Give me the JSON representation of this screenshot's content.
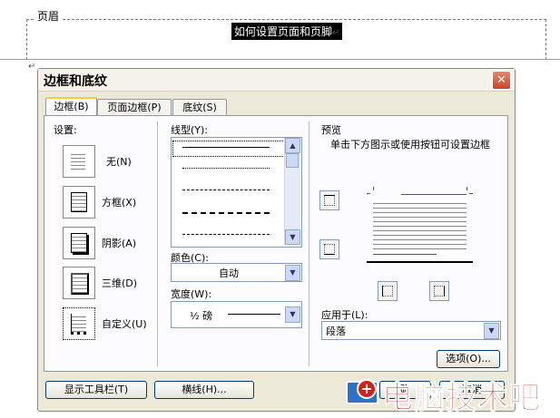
{
  "document": {
    "header_tab": "页眉",
    "selected_text": "如何设置页面和页脚",
    "para_mark": "↵"
  },
  "dialog": {
    "title": "边框和底纹",
    "close_glyph": "✕",
    "tabs": [
      "边框(B)",
      "页面边框(P)",
      "底纹(S)"
    ],
    "settings_label": "设置:",
    "settings": [
      {
        "label": "无(N)",
        "icon": "border-none-icon"
      },
      {
        "label": "方框(X)",
        "icon": "border-box-icon"
      },
      {
        "label": "阴影(A)",
        "icon": "border-shadow-icon"
      },
      {
        "label": "三维(D)",
        "icon": "border-3d-icon"
      },
      {
        "label": "自定义(U)",
        "icon": "border-custom-icon"
      }
    ],
    "line_style_label": "线型(Y):",
    "color_label": "颜色(C):",
    "color_value": "自动",
    "width_label": "宽度(W):",
    "width_value": "½ 磅",
    "preview_label": "预览",
    "preview_hint": "单击下方图示或使用按钮可设置边框",
    "apply_to_label": "应用于(L):",
    "apply_to_value": "段落",
    "options_button": "选项(O)...",
    "show_toolbar_button": "显示工具栏(T)",
    "horizontal_line_button": "横线(H)...",
    "ok_partial": "确",
    "cancel_partial": "取消"
  },
  "watermark": {
    "text": "电脑技术吧"
  },
  "colors": {
    "dialog_bg": "#ece9d8",
    "tab_highlight": "#ffc83c",
    "watermark_red": "#d0221b",
    "close_red": "#c8442a"
  }
}
